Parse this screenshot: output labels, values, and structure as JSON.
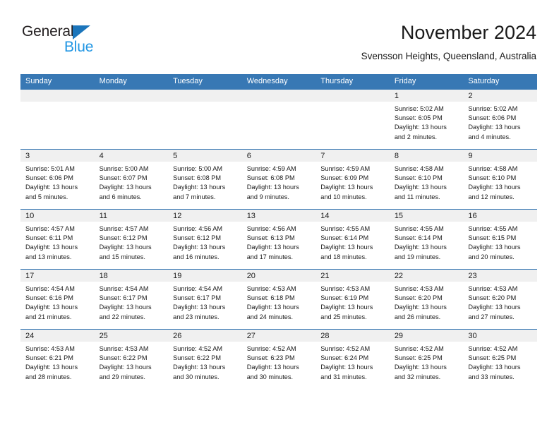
{
  "brand": {
    "name_part1": "General",
    "name_part2": "Blue",
    "triangle_icon": "blue-triangle-icon",
    "accent_color": "#1b75bb",
    "secondary_color": "#2196e3"
  },
  "header": {
    "title": "November 2024",
    "subtitle": "Svensson Heights, Queensland, Australia"
  },
  "theme": {
    "header_blue": "#3878b4",
    "daynum_band": "#f0f0f0",
    "text": "#1a1a1a"
  },
  "weekdays": [
    "Sunday",
    "Monday",
    "Tuesday",
    "Wednesday",
    "Thursday",
    "Friday",
    "Saturday"
  ],
  "weeks": [
    [
      {
        "day": "",
        "sunrise": "",
        "sunset": "",
        "daylight1": "",
        "daylight2": ""
      },
      {
        "day": "",
        "sunrise": "",
        "sunset": "",
        "daylight1": "",
        "daylight2": ""
      },
      {
        "day": "",
        "sunrise": "",
        "sunset": "",
        "daylight1": "",
        "daylight2": ""
      },
      {
        "day": "",
        "sunrise": "",
        "sunset": "",
        "daylight1": "",
        "daylight2": ""
      },
      {
        "day": "",
        "sunrise": "",
        "sunset": "",
        "daylight1": "",
        "daylight2": ""
      },
      {
        "day": "1",
        "sunrise": "Sunrise: 5:02 AM",
        "sunset": "Sunset: 6:05 PM",
        "daylight1": "Daylight: 13 hours",
        "daylight2": "and 2 minutes."
      },
      {
        "day": "2",
        "sunrise": "Sunrise: 5:02 AM",
        "sunset": "Sunset: 6:06 PM",
        "daylight1": "Daylight: 13 hours",
        "daylight2": "and 4 minutes."
      }
    ],
    [
      {
        "day": "3",
        "sunrise": "Sunrise: 5:01 AM",
        "sunset": "Sunset: 6:06 PM",
        "daylight1": "Daylight: 13 hours",
        "daylight2": "and 5 minutes."
      },
      {
        "day": "4",
        "sunrise": "Sunrise: 5:00 AM",
        "sunset": "Sunset: 6:07 PM",
        "daylight1": "Daylight: 13 hours",
        "daylight2": "and 6 minutes."
      },
      {
        "day": "5",
        "sunrise": "Sunrise: 5:00 AM",
        "sunset": "Sunset: 6:08 PM",
        "daylight1": "Daylight: 13 hours",
        "daylight2": "and 7 minutes."
      },
      {
        "day": "6",
        "sunrise": "Sunrise: 4:59 AM",
        "sunset": "Sunset: 6:08 PM",
        "daylight1": "Daylight: 13 hours",
        "daylight2": "and 9 minutes."
      },
      {
        "day": "7",
        "sunrise": "Sunrise: 4:59 AM",
        "sunset": "Sunset: 6:09 PM",
        "daylight1": "Daylight: 13 hours",
        "daylight2": "and 10 minutes."
      },
      {
        "day": "8",
        "sunrise": "Sunrise: 4:58 AM",
        "sunset": "Sunset: 6:10 PM",
        "daylight1": "Daylight: 13 hours",
        "daylight2": "and 11 minutes."
      },
      {
        "day": "9",
        "sunrise": "Sunrise: 4:58 AM",
        "sunset": "Sunset: 6:10 PM",
        "daylight1": "Daylight: 13 hours",
        "daylight2": "and 12 minutes."
      }
    ],
    [
      {
        "day": "10",
        "sunrise": "Sunrise: 4:57 AM",
        "sunset": "Sunset: 6:11 PM",
        "daylight1": "Daylight: 13 hours",
        "daylight2": "and 13 minutes."
      },
      {
        "day": "11",
        "sunrise": "Sunrise: 4:57 AM",
        "sunset": "Sunset: 6:12 PM",
        "daylight1": "Daylight: 13 hours",
        "daylight2": "and 15 minutes."
      },
      {
        "day": "12",
        "sunrise": "Sunrise: 4:56 AM",
        "sunset": "Sunset: 6:12 PM",
        "daylight1": "Daylight: 13 hours",
        "daylight2": "and 16 minutes."
      },
      {
        "day": "13",
        "sunrise": "Sunrise: 4:56 AM",
        "sunset": "Sunset: 6:13 PM",
        "daylight1": "Daylight: 13 hours",
        "daylight2": "and 17 minutes."
      },
      {
        "day": "14",
        "sunrise": "Sunrise: 4:55 AM",
        "sunset": "Sunset: 6:14 PM",
        "daylight1": "Daylight: 13 hours",
        "daylight2": "and 18 minutes."
      },
      {
        "day": "15",
        "sunrise": "Sunrise: 4:55 AM",
        "sunset": "Sunset: 6:14 PM",
        "daylight1": "Daylight: 13 hours",
        "daylight2": "and 19 minutes."
      },
      {
        "day": "16",
        "sunrise": "Sunrise: 4:55 AM",
        "sunset": "Sunset: 6:15 PM",
        "daylight1": "Daylight: 13 hours",
        "daylight2": "and 20 minutes."
      }
    ],
    [
      {
        "day": "17",
        "sunrise": "Sunrise: 4:54 AM",
        "sunset": "Sunset: 6:16 PM",
        "daylight1": "Daylight: 13 hours",
        "daylight2": "and 21 minutes."
      },
      {
        "day": "18",
        "sunrise": "Sunrise: 4:54 AM",
        "sunset": "Sunset: 6:17 PM",
        "daylight1": "Daylight: 13 hours",
        "daylight2": "and 22 minutes."
      },
      {
        "day": "19",
        "sunrise": "Sunrise: 4:54 AM",
        "sunset": "Sunset: 6:17 PM",
        "daylight1": "Daylight: 13 hours",
        "daylight2": "and 23 minutes."
      },
      {
        "day": "20",
        "sunrise": "Sunrise: 4:53 AM",
        "sunset": "Sunset: 6:18 PM",
        "daylight1": "Daylight: 13 hours",
        "daylight2": "and 24 minutes."
      },
      {
        "day": "21",
        "sunrise": "Sunrise: 4:53 AM",
        "sunset": "Sunset: 6:19 PM",
        "daylight1": "Daylight: 13 hours",
        "daylight2": "and 25 minutes."
      },
      {
        "day": "22",
        "sunrise": "Sunrise: 4:53 AM",
        "sunset": "Sunset: 6:20 PM",
        "daylight1": "Daylight: 13 hours",
        "daylight2": "and 26 minutes."
      },
      {
        "day": "23",
        "sunrise": "Sunrise: 4:53 AM",
        "sunset": "Sunset: 6:20 PM",
        "daylight1": "Daylight: 13 hours",
        "daylight2": "and 27 minutes."
      }
    ],
    [
      {
        "day": "24",
        "sunrise": "Sunrise: 4:53 AM",
        "sunset": "Sunset: 6:21 PM",
        "daylight1": "Daylight: 13 hours",
        "daylight2": "and 28 minutes."
      },
      {
        "day": "25",
        "sunrise": "Sunrise: 4:53 AM",
        "sunset": "Sunset: 6:22 PM",
        "daylight1": "Daylight: 13 hours",
        "daylight2": "and 29 minutes."
      },
      {
        "day": "26",
        "sunrise": "Sunrise: 4:52 AM",
        "sunset": "Sunset: 6:22 PM",
        "daylight1": "Daylight: 13 hours",
        "daylight2": "and 30 minutes."
      },
      {
        "day": "27",
        "sunrise": "Sunrise: 4:52 AM",
        "sunset": "Sunset: 6:23 PM",
        "daylight1": "Daylight: 13 hours",
        "daylight2": "and 30 minutes."
      },
      {
        "day": "28",
        "sunrise": "Sunrise: 4:52 AM",
        "sunset": "Sunset: 6:24 PM",
        "daylight1": "Daylight: 13 hours",
        "daylight2": "and 31 minutes."
      },
      {
        "day": "29",
        "sunrise": "Sunrise: 4:52 AM",
        "sunset": "Sunset: 6:25 PM",
        "daylight1": "Daylight: 13 hours",
        "daylight2": "and 32 minutes."
      },
      {
        "day": "30",
        "sunrise": "Sunrise: 4:52 AM",
        "sunset": "Sunset: 6:25 PM",
        "daylight1": "Daylight: 13 hours",
        "daylight2": "and 33 minutes."
      }
    ]
  ]
}
